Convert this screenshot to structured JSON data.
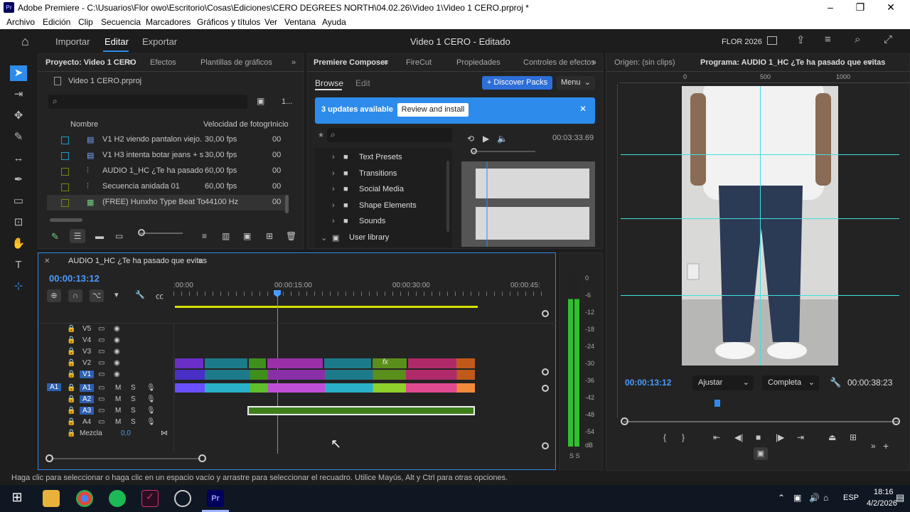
{
  "window": {
    "title": "Adobe Premiere - C:\\Usuarios\\Flor owo\\Escritorio\\Cosas\\Ediciones\\CERO DEGREES NORTH\\04.02.26\\Video 1\\Video 1 CERO.prproj *",
    "logo": "Pr"
  },
  "menu": [
    "Archivo",
    "Edición",
    "Clip",
    "Secuencia",
    "Marcadores",
    "Gráficos y títulos",
    "Ver",
    "Ventana",
    "Ayuda"
  ],
  "workspace": {
    "import": "Importar",
    "edit": "Editar",
    "export": "Exportar",
    "title": "Video 1 CERO - Editado",
    "user": "FLOR 2026"
  },
  "project": {
    "tabs": [
      "Proyecto: Video 1 CERO",
      "Efectos",
      "Plantillas de gráficos"
    ],
    "file": "Video 1 CERO.prproj",
    "count": "1...",
    "headers": {
      "name": "Nombre",
      "fps": "Velocidad de fotogr",
      "start": "Inicio"
    },
    "items": [
      {
        "name": "V1 H2 viendo pantalon viejo.",
        "fps": "30,00 fps",
        "start": "00",
        "color": "#1e9ec8"
      },
      {
        "name": "V1 H3 intenta botar jeans + s",
        "fps": "30,00 fps",
        "start": "00",
        "color": "#1e9ec8"
      },
      {
        "name": "AUDIO 1_HC ¿Te ha pasado",
        "fps": "60,00 fps",
        "start": "00",
        "color": "#6f8a10"
      },
      {
        "name": "Secuencia anidada 01",
        "fps": "60,00 fps",
        "start": "00",
        "color": "#6f8a10"
      },
      {
        "name": "(FREE) Hunxho Type Beat To",
        "fps": "44100 Hz",
        "start": "00",
        "color": "#6f8a10"
      }
    ]
  },
  "composer": {
    "tabs": [
      "Premiere Composer",
      "FireCut",
      "Propiedades",
      "Controles de efectos"
    ],
    "browse": "Browse",
    "edit": "Edit",
    "discover": "+ Discover Packs",
    "menu": "Menu",
    "banner": {
      "text": "3 updates available",
      "button": "Review and install"
    },
    "folders": [
      "Text Presets",
      "Transitions",
      "Social Media",
      "Shape Elements",
      "Sounds"
    ],
    "library": "User library",
    "time": "00:03:33.69"
  },
  "monitor": {
    "source": "Origen: (sin clips)",
    "program": "Programa: AUDIO 1_HC ¿Te ha pasado que evitas",
    "ruler": [
      "0",
      "500",
      "1000"
    ],
    "timecode": "00:00:13:12",
    "fit": "Ajustar",
    "quality": "Completa",
    "duration": "00:00:38:23"
  },
  "timeline": {
    "title": "AUDIO 1_HC ¿Te ha pasado que evitas",
    "timecode": "00:00:13:12",
    "ruler": [
      ":00:00",
      "00:00:15:00",
      "00:00:30:00",
      "00:00:45:"
    ],
    "video_tracks": [
      "V5",
      "V4",
      "V3",
      "V2",
      "V1"
    ],
    "audio_tracks": [
      "A1",
      "A2",
      "A3",
      "A4"
    ],
    "mix_label": "Mezcla",
    "mix_value": "0,0",
    "m": "M",
    "s": "S"
  },
  "meter": {
    "scale": [
      "0",
      "-6",
      "-12",
      "-18",
      "-24",
      "-30",
      "-36",
      "-42",
      "-48",
      "-54",
      "dB"
    ],
    "solo": "S S"
  },
  "status": "Haga clic para seleccionar o haga clic en un espacio vacío y arrastre para seleccionar el recuadro. Utilice Mayús, Alt y Ctrl para otras opciones.",
  "taskbar": {
    "lang": "ESP",
    "time": "18:16",
    "date": "4/2/2026"
  },
  "colors": {
    "accent": "#2d8ceb",
    "selection": "#4a90e2"
  }
}
